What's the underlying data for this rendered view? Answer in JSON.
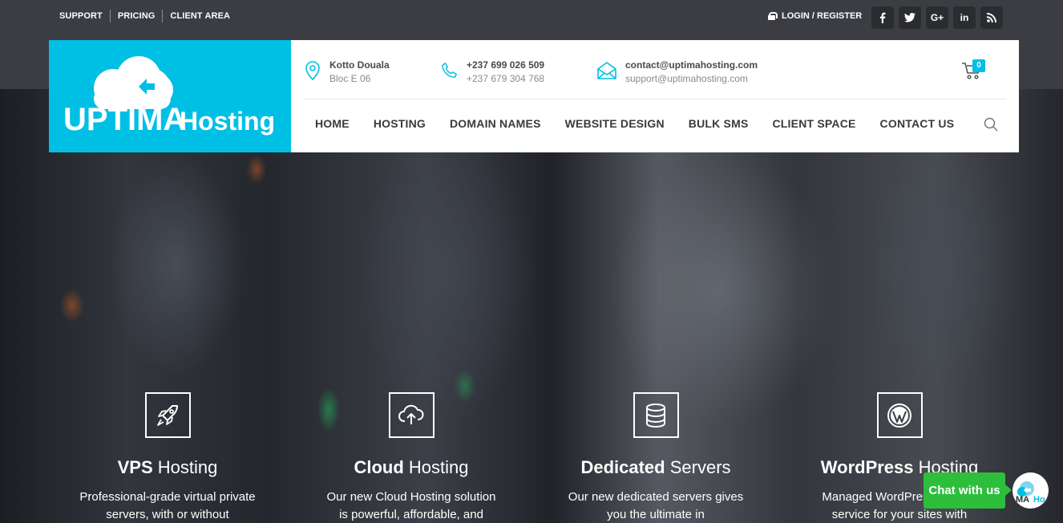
{
  "topbar": {
    "links": [
      "SUPPORT",
      "PRICING",
      "CLIENT AREA"
    ],
    "login_label": "LOGIN / REGISTER",
    "social": [
      {
        "icon": "facebook-icon",
        "glyph": "f"
      },
      {
        "icon": "twitter-icon",
        "glyph": "t"
      },
      {
        "icon": "google-plus-icon",
        "glyph": "G+"
      },
      {
        "icon": "linkedin-icon",
        "glyph": "in"
      },
      {
        "icon": "rss-icon",
        "glyph": "rss"
      }
    ]
  },
  "logo": {
    "text_bold": "UPTIMA",
    "text_light": "Hosting",
    "bg_color": "#00bfe5"
  },
  "contacts": [
    {
      "icon": "map-pin-icon",
      "line1": "Kotto Douala",
      "line2": "Bloc E 06"
    },
    {
      "icon": "phone-icon",
      "line1": "+237 699 026 509",
      "line2": "+237 679 304 768"
    },
    {
      "icon": "envelope-icon",
      "line1": "contact@uptimahosting.com",
      "line2": "support@uptimahosting.com"
    }
  ],
  "cart": {
    "count": "0"
  },
  "nav": [
    "HOME",
    "HOSTING",
    "DOMAIN NAMES",
    "WEBSITE DESIGN",
    "BULK SMS",
    "CLIENT SPACE",
    "CONTACT US"
  ],
  "services": [
    {
      "icon": "rocket-icon",
      "bold": "VPS",
      "light": " Hosting",
      "desc": "Professional-grade virtual private servers, with or without"
    },
    {
      "icon": "cloud-upload-icon",
      "bold": "Cloud",
      "light": " Hosting",
      "desc": "Our new Cloud Hosting solution is powerful, affordable, and"
    },
    {
      "icon": "database-icon",
      "bold": "Dedicated",
      "light": " Servers",
      "desc": "Our new dedicated servers gives you the ultimate in"
    },
    {
      "icon": "wordpress-icon",
      "bold": "WordPress",
      "light": " Hosting",
      "desc": "Managed WordPress hosting service for your sites with"
    }
  ],
  "chat": {
    "label": "Chat with us"
  },
  "colors": {
    "accent": "#00bfe5",
    "chat": "#2dbe3c",
    "topbar": "#3c3d43"
  }
}
